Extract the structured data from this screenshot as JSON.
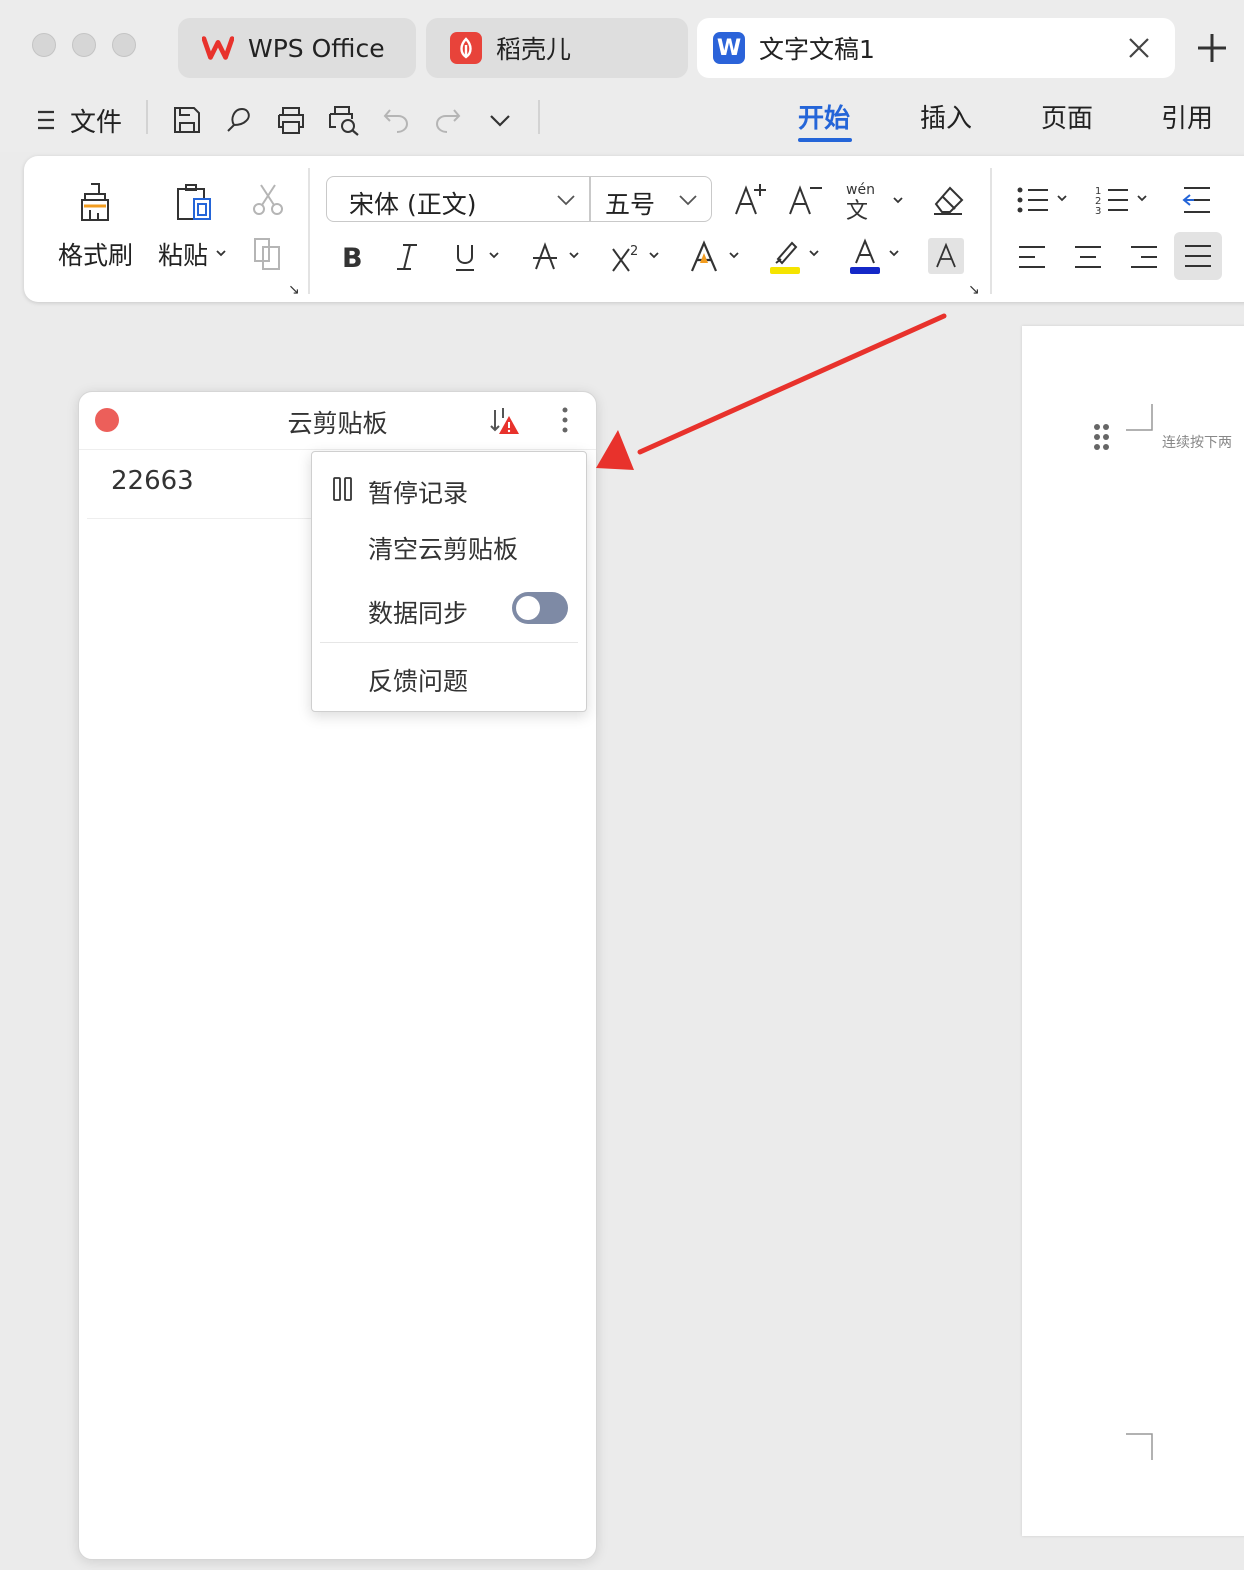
{
  "tabs": [
    {
      "label": "WPS Office",
      "icon": "wps-logo-icon"
    },
    {
      "label": "稻壳儿",
      "icon": "docer-logo-icon"
    },
    {
      "label": "文字文稿1",
      "icon": "writer-doc-icon",
      "active": true
    }
  ],
  "menu": {
    "file_label": "文件",
    "ribbon_tabs": [
      "开始",
      "插入",
      "页面",
      "引用"
    ],
    "active_tab": "开始"
  },
  "ribbon": {
    "format_painter": "格式刷",
    "paste": "粘贴",
    "font_name": "宋体 (正文)",
    "font_size": "五号"
  },
  "clipboard_panel": {
    "title": "云剪贴板",
    "items": [
      "22663"
    ]
  },
  "dropdown": {
    "pause": "暂停记录",
    "clear": "清空云剪贴板",
    "sync": "数据同步",
    "sync_enabled": false,
    "feedback": "反馈问题"
  },
  "document": {
    "hint_text": "连续按下两"
  },
  "colors": {
    "accent": "#2465d8",
    "highlight": "#f5e400",
    "font_color": "#1428c8",
    "close_red": "#ec5f5a",
    "annotation_arrow": "#e8322c"
  }
}
